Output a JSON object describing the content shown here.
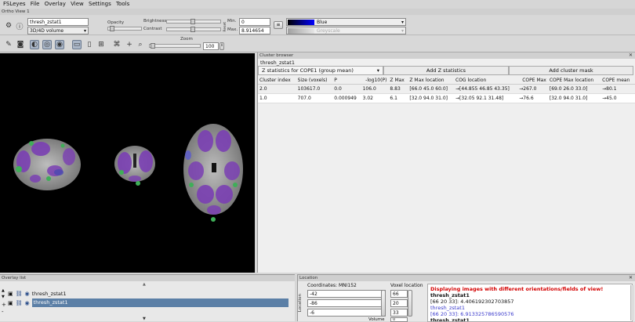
{
  "menu": [
    "FSLeyes",
    "File",
    "Overlay",
    "View",
    "Settings",
    "Tools"
  ],
  "view_title": "Ortho View 1",
  "toolbar": {
    "overlay_name": "thresh_zstat1",
    "overlay_type": "3D/4D volume",
    "opacity_label": "Opacity",
    "brightness_label": "Brightness",
    "contrast_label": "Contrast",
    "min_label": "Min.",
    "max_label": "Max.",
    "min_value": "0",
    "max_value": "8.914654",
    "reset_label": "Reset",
    "colormap": "Blue",
    "neg_colormap": "Greyscale",
    "zoom_label": "Zoom",
    "zoom_value": "100"
  },
  "cluster_browser": {
    "title": "Cluster browser",
    "subtitle": "thresh_zstat1",
    "contrast_select": "Z statistics for COPE1 (group mean)",
    "add_z_button": "Add Z statistics",
    "add_cluster_button": "Add cluster mask",
    "columns": [
      "Cluster index",
      "Size (voxels)",
      "P",
      "-log10(P)",
      "Z Max",
      "Z Max location",
      "COG location",
      "COPE Max",
      "COPE Max location",
      "COPE mean"
    ],
    "rows": [
      [
        "2.0",
        "103617.0",
        "0.0",
        "106.0",
        "8.83",
        "[66.0 45.0 60.0]",
        "→[44.855 46.85 43.35]",
        "→267.0",
        "[69.0 26.0 33.0]",
        "→80.1"
      ],
      [
        "1.0",
        "707.0",
        "0.000949",
        "3.02",
        "6.1",
        "[32.0 94.0 31.0]",
        "→[32.05 92.1 31.48]",
        "→76.6",
        "[32.0 94.0 31.0]",
        "→45.0"
      ]
    ]
  },
  "overlay_list": {
    "title": "Overlay list",
    "items": [
      "thresh_zstat1",
      "thresh_zstat1"
    ]
  },
  "location": {
    "title": "Location",
    "coord_label": "Coordinates: MNI152",
    "voxel_label": "Voxel location",
    "side_label": "Location",
    "coords": [
      "-42",
      "-86",
      "-6"
    ],
    "voxels": [
      "66",
      "20",
      "33"
    ],
    "volume_label": "Volume",
    "volume_value": "0",
    "warning": "Displaying images with different orientations/fields of view!",
    "info": [
      {
        "text": "thresh_zstat1",
        "color": "#000000"
      },
      {
        "text": "[66 20 33]: 4.406192302703857",
        "color": "#000000"
      },
      {
        "text": "thresh_zstat1",
        "color": "#3a3acc"
      },
      {
        "text": "[66 20 33]: 6.913325786590576",
        "color": "#3a3acc"
      },
      {
        "text": "thresh_zstat1",
        "color": "#000000"
      }
    ]
  },
  "colors": {
    "accent": "#5a7fa8",
    "overlay_purple": "#7a3fb3",
    "overlay_green": "#3fae58",
    "selected_row": "#5b7fa6"
  }
}
